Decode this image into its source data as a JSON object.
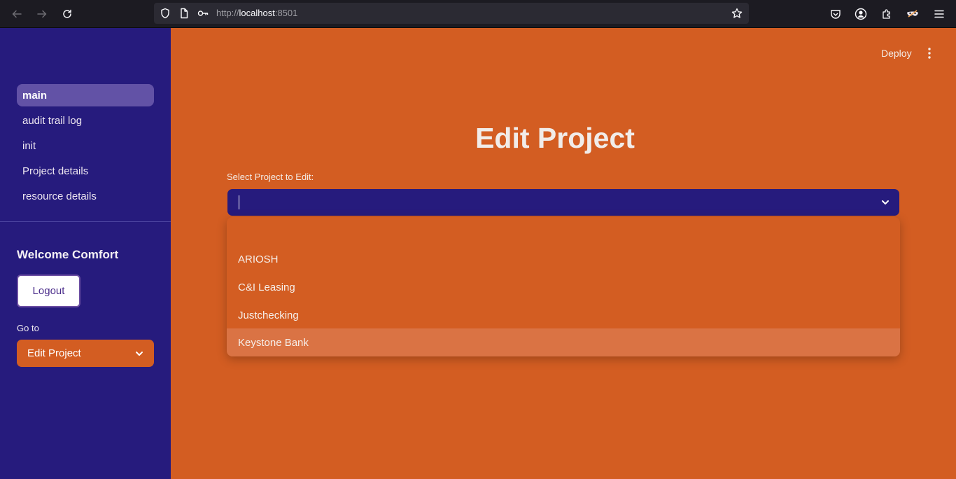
{
  "browser": {
    "url_prefix": "http://",
    "url_host": "localhost",
    "url_port": ":8501"
  },
  "sidebar": {
    "nav_items": [
      {
        "label": "main",
        "active": true
      },
      {
        "label": "audit trail log"
      },
      {
        "label": "init"
      },
      {
        "label": "Project details"
      },
      {
        "label": "resource details"
      }
    ],
    "welcome_text": "Welcome Comfort",
    "logout_label": "Logout",
    "goto_label": "Go to",
    "goto_value": "Edit Project"
  },
  "header": {
    "deploy_label": "Deploy"
  },
  "main": {
    "title": "Edit Project",
    "select_label": "Select Project to Edit:",
    "select_value": "",
    "options": [
      "",
      "ARIOSH",
      "C&I Leasing",
      "Justchecking",
      "Keystone Bank"
    ],
    "hovered_option": "Keystone Bank"
  },
  "colors": {
    "sidebar_bg": "#261b7d",
    "main_bg": "#d35d22",
    "active_nav_bg": "#6252a6",
    "hover_option_bg": "#da7344"
  }
}
